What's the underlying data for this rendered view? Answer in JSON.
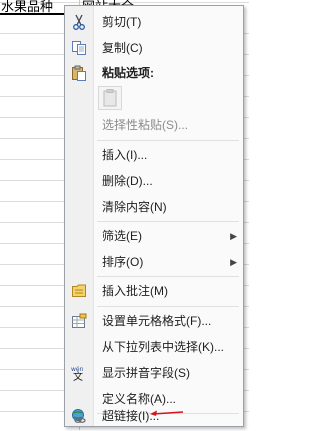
{
  "sheet": {
    "cell_a1": "水果品种",
    "cell_b1": "网站大全"
  },
  "menu": {
    "items": [
      {
        "label": "剪切(T)",
        "icon": "scissors-icon"
      },
      {
        "label": "复制(C)",
        "icon": "copy-icon"
      },
      {
        "label": "粘贴选项:",
        "icon": "paste-icon"
      },
      {
        "label": "选择性粘贴(S)...",
        "icon": ""
      },
      {
        "label": "插入(I)...",
        "icon": ""
      },
      {
        "label": "删除(D)...",
        "icon": ""
      },
      {
        "label": "清除内容(N)",
        "icon": ""
      },
      {
        "label": "筛选(E)",
        "icon": ""
      },
      {
        "label": "排序(O)",
        "icon": ""
      },
      {
        "label": "插入批注(M)",
        "icon": "comment-icon"
      },
      {
        "label": "设置单元格格式(F)...",
        "icon": "format-cells-icon"
      },
      {
        "label": "从下拉列表中选择(K)...",
        "icon": ""
      },
      {
        "label": "显示拼音字段(S)",
        "icon": "phonetic-icon"
      },
      {
        "label": "定义名称(A)...",
        "icon": ""
      },
      {
        "label": "超链接(I)...",
        "icon": "hyperlink-icon"
      }
    ]
  },
  "colors": {
    "annotation_arrow": "#d4141c",
    "menu_background": "#fafafa",
    "gutter": "#f0f0f0"
  }
}
